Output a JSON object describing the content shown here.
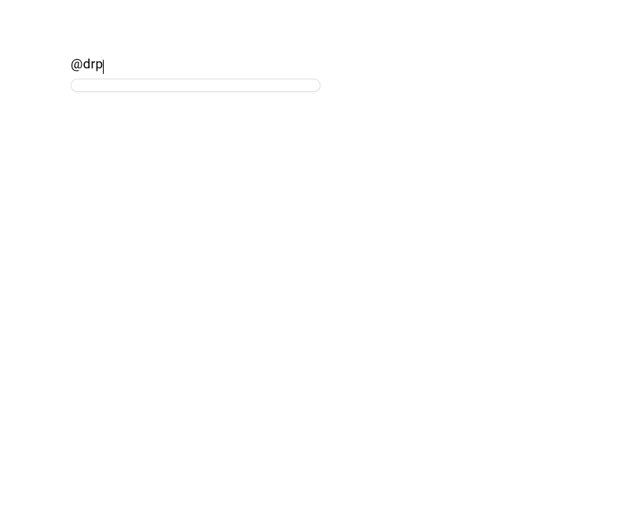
{
  "form": {
    "label": "@drp",
    "input_value": ""
  }
}
